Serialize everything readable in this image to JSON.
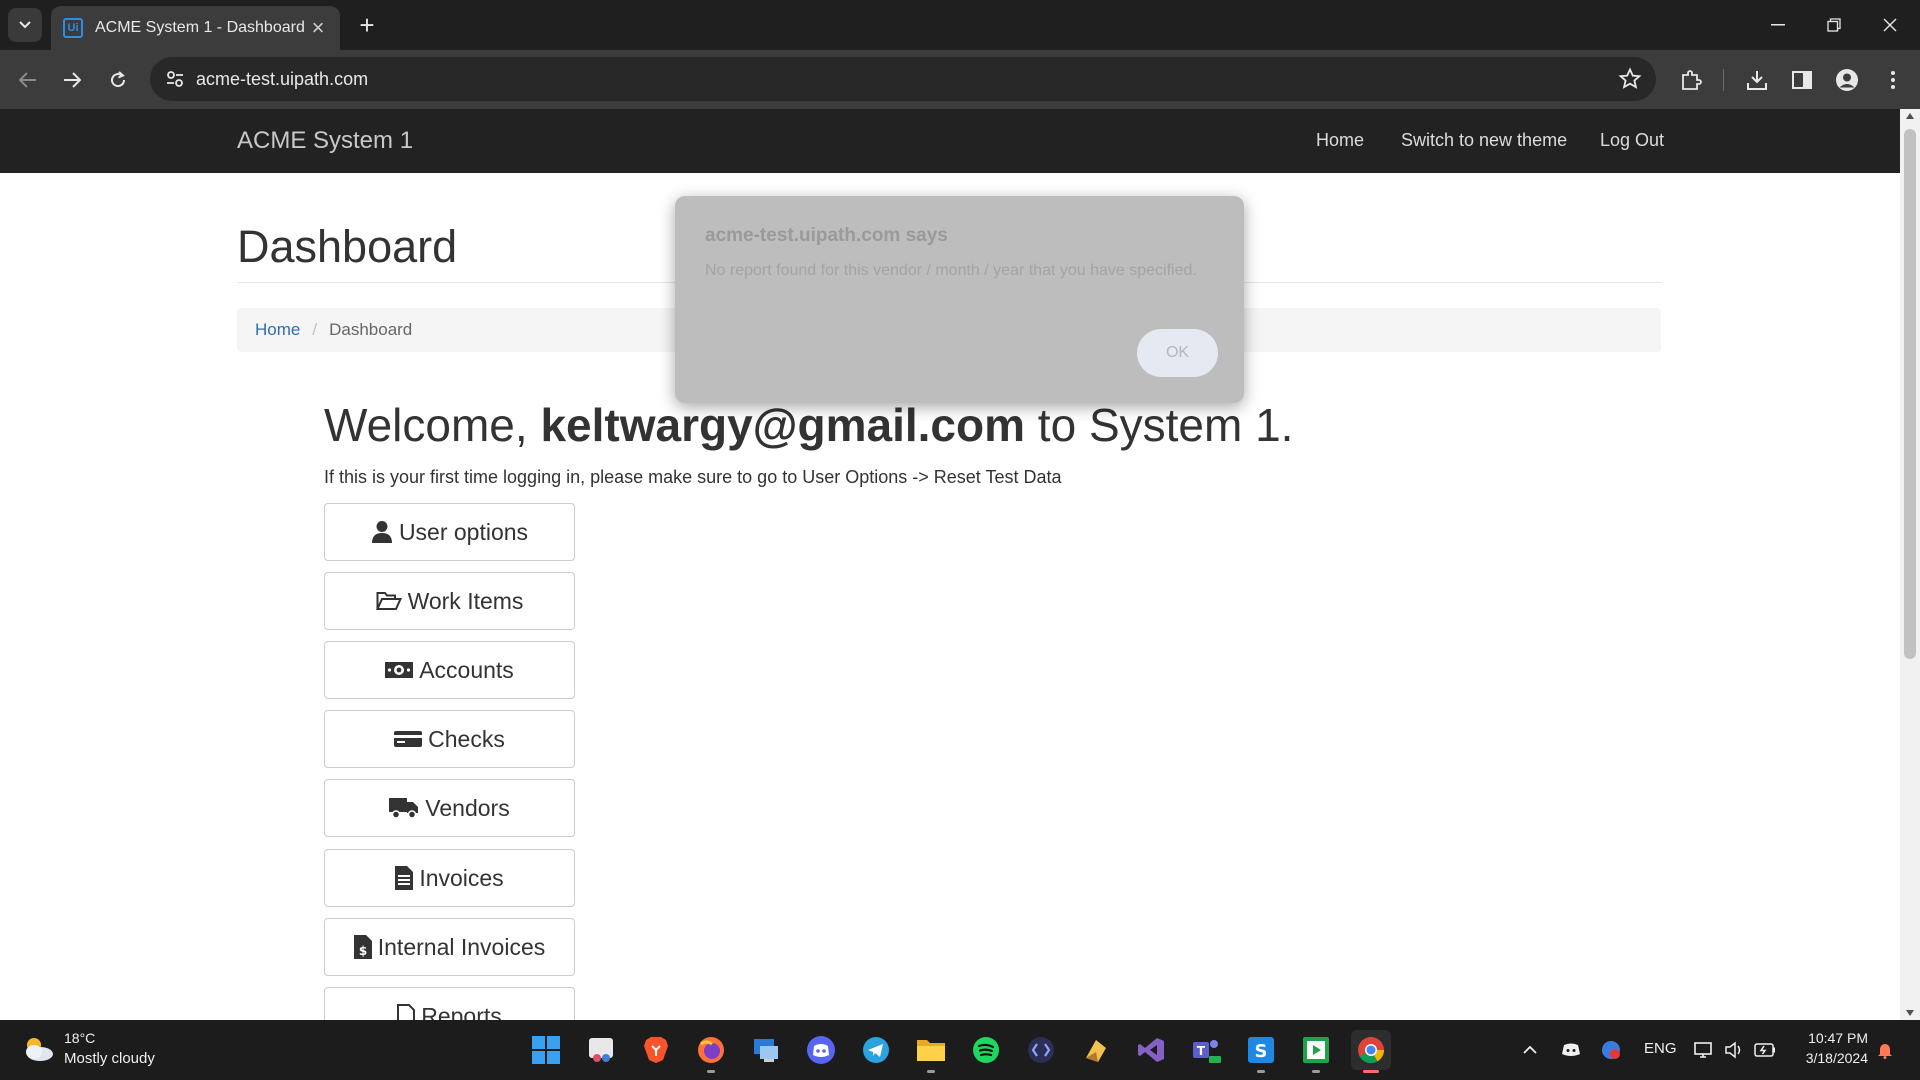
{
  "browser": {
    "tab_title": "ACME System 1 - Dashboard",
    "tab_favicon": "Ui",
    "url": "acme-test.uipath.com"
  },
  "site": {
    "brand": "ACME System 1",
    "nav": {
      "home": "Home",
      "switch_theme": "Switch to new theme",
      "logout": "Log Out"
    },
    "page_title": "Dashboard",
    "breadcrumb": {
      "home": "Home",
      "current": "Dashboard"
    },
    "welcome": {
      "prefix": "Welcome, ",
      "user": "keltwargy@gmail.com",
      "suffix": " to System 1."
    },
    "hint": "If this is your first time logging in, please make sure to go to User Options -> Reset Test Data",
    "menu": [
      {
        "label": "User options",
        "icon": "user-icon"
      },
      {
        "label": "Work Items",
        "icon": "folder-open-icon"
      },
      {
        "label": "Accounts",
        "icon": "money-icon"
      },
      {
        "label": "Checks",
        "icon": "credit-card-icon"
      },
      {
        "label": "Vendors",
        "icon": "truck-icon"
      },
      {
        "label": "Invoices",
        "icon": "file-text-icon"
      },
      {
        "label": "Internal Invoices",
        "icon": "file-dollar-icon"
      },
      {
        "label": "Reports",
        "icon": "file-icon"
      }
    ]
  },
  "dialog": {
    "title": "acme-test.uipath.com says",
    "message": "No report found for this vendor / month / year that you have specified.",
    "ok": "OK"
  },
  "taskbar": {
    "weather_temp": "18°C",
    "weather_desc": "Mostly cloudy",
    "language": "ENG",
    "time": "10:47 PM",
    "date": "3/18/2024",
    "apps": [
      "start-icon",
      "snipping-tool-icon",
      "brave-icon",
      "firefox-icon",
      "remote-desktop-icon",
      "discord-icon",
      "telegram-icon",
      "file-explorer-icon",
      "spotify-icon",
      "dev-tool-icon",
      "app-icon",
      "visual-studio-icon",
      "teams-icon",
      "s-app-icon",
      "media-app-icon",
      "chrome-icon"
    ]
  },
  "colors": {
    "site_nav": "#222222",
    "link": "#2a6fb0",
    "accent_blue": "#2d8ee6"
  }
}
